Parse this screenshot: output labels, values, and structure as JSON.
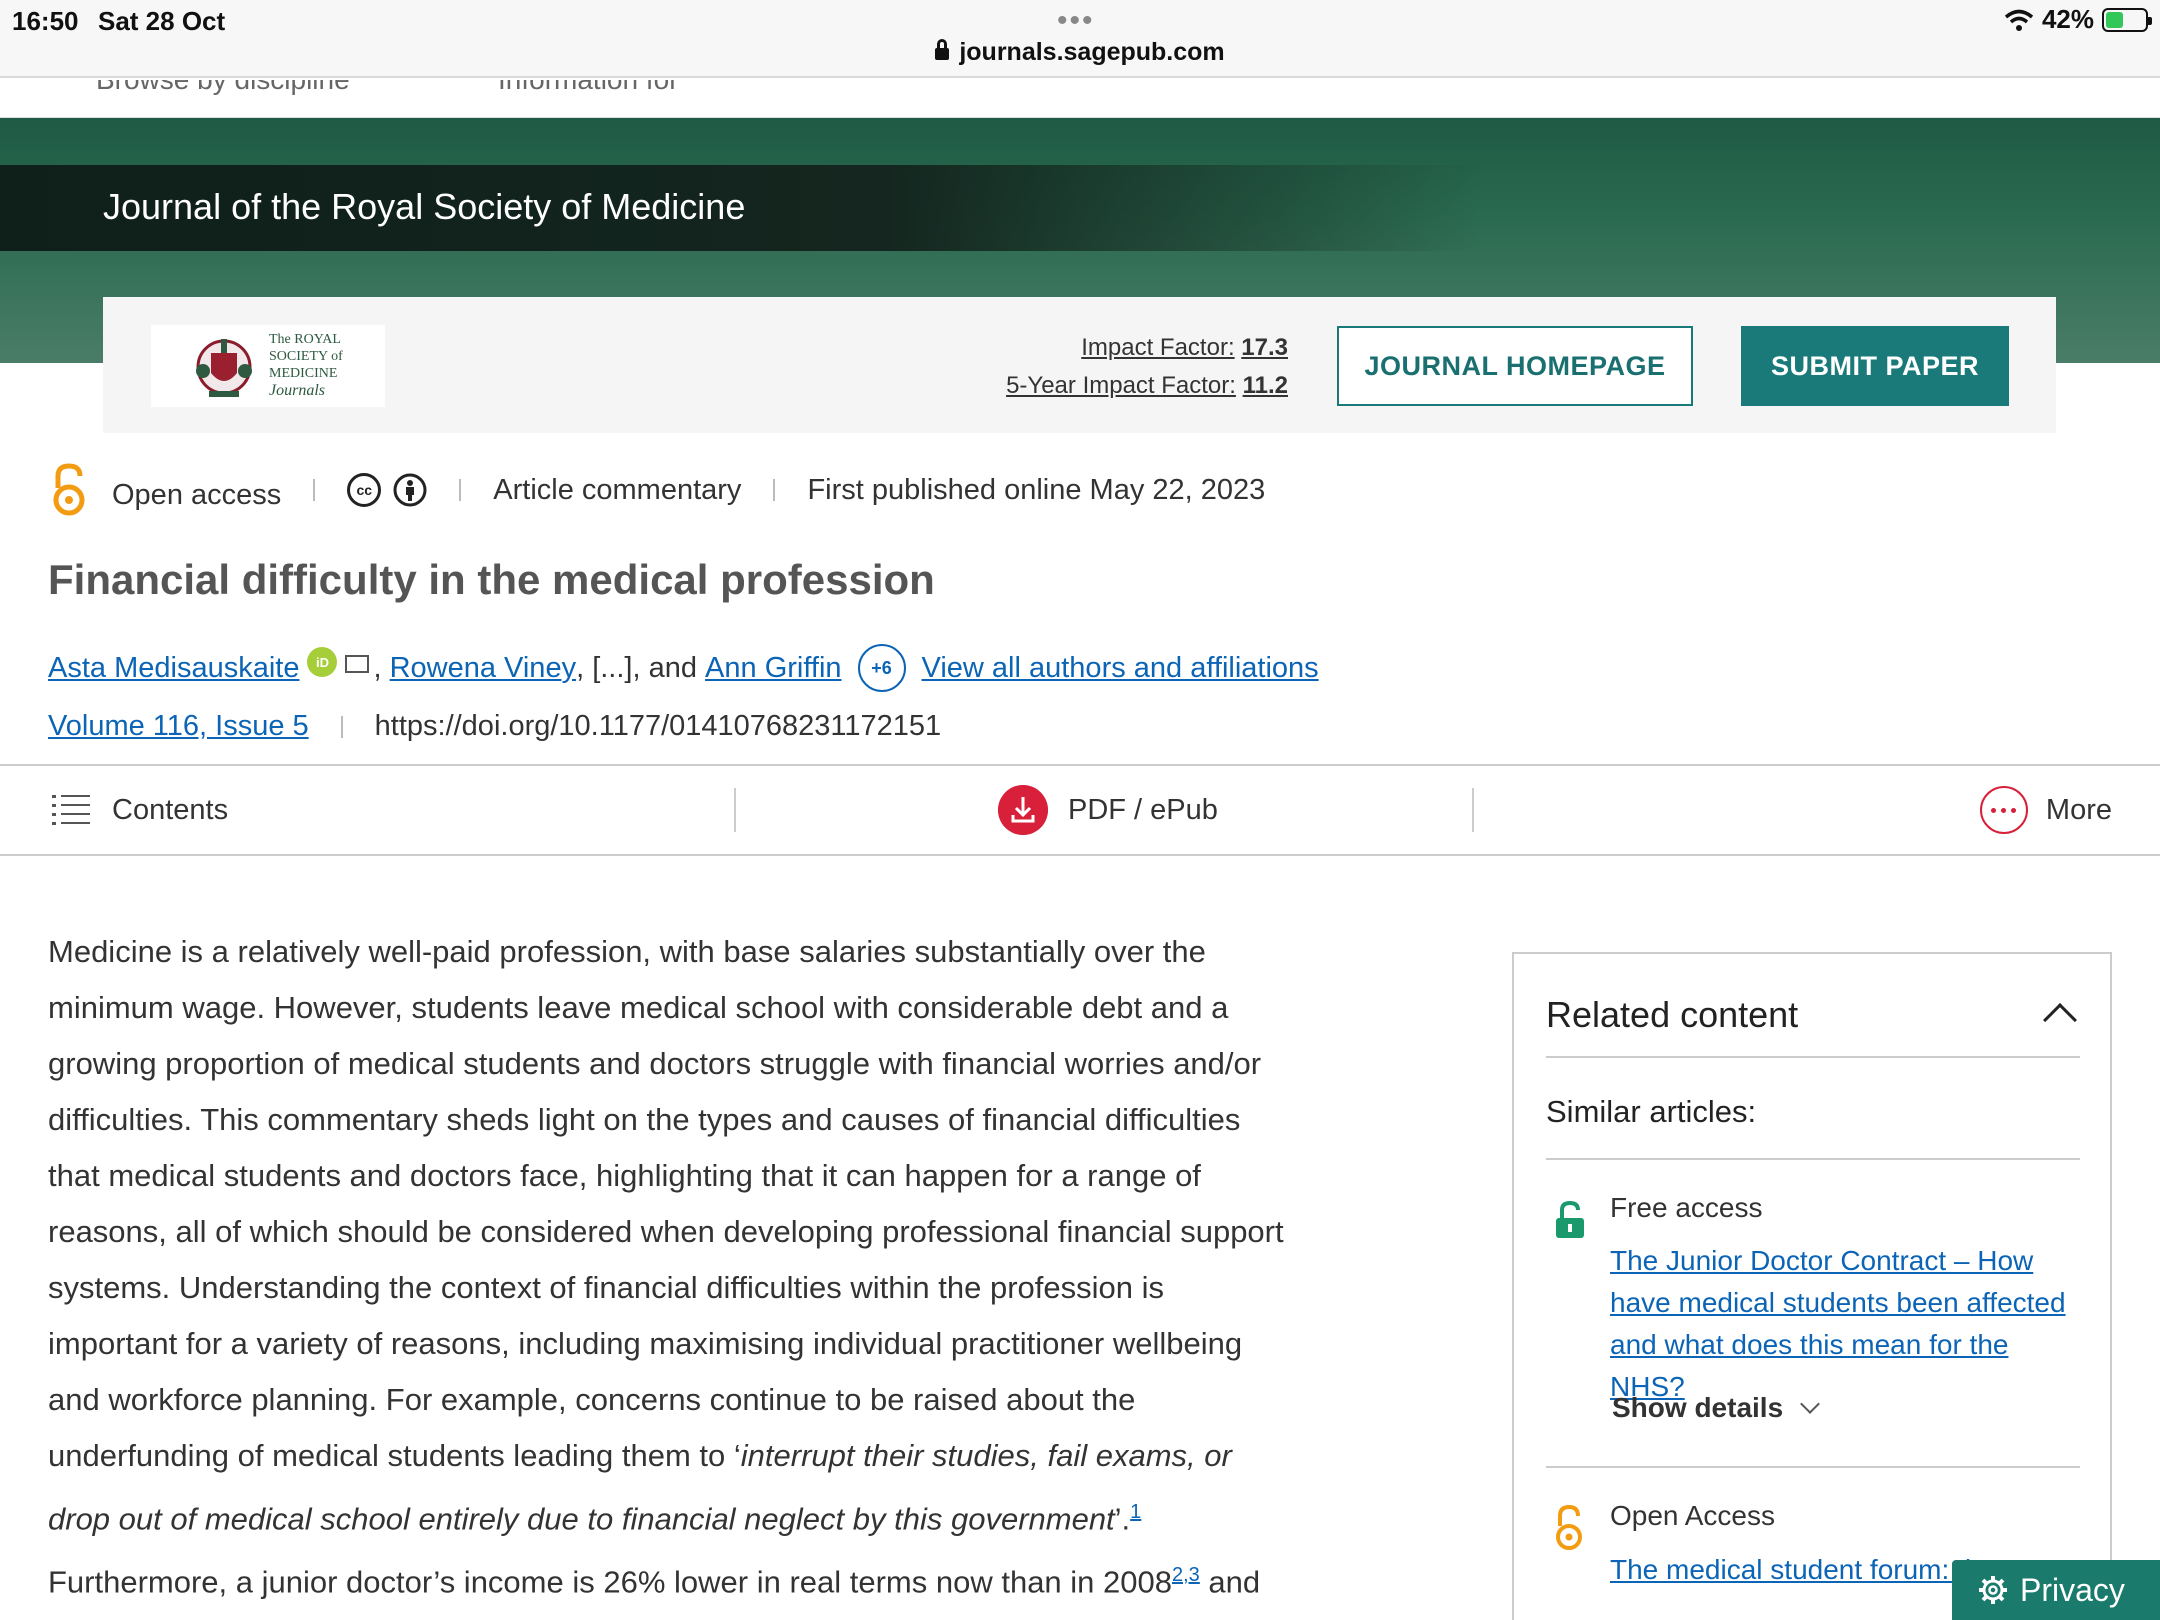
{
  "status_bar": {
    "time": "16:50",
    "date": "Sat 28 Oct",
    "url": "journals.sagepub.com",
    "battery": "42%"
  },
  "subnav": {
    "browse_label": "Browse by discipline",
    "info_label": "Information for"
  },
  "journal": {
    "title": "Journal of the Royal Society of Medicine",
    "logo_line1": "The ROYAL",
    "logo_line2": "SOCIETY of",
    "logo_line3": "MEDICINE",
    "logo_line4": "Journals",
    "impact_label": "Impact Factor:",
    "impact_value": "17.3",
    "impact5_label": "5-Year Impact Factor:",
    "impact5_value": "11.2",
    "homepage_button": "JOURNAL HOMEPAGE",
    "submit_button": "SUBMIT PAPER"
  },
  "meta": {
    "access": "Open access",
    "cc": "cc",
    "type": "Article commentary",
    "published": "First published online May 22, 2023"
  },
  "article": {
    "title": "Financial difficulty in the medical profession",
    "author1": "Asta Medisauskaite",
    "author2": "Rowena Viney",
    "ellipsis": ", [...], and ",
    "author3": "Ann Griffin",
    "more_count": "+6",
    "view_all": "View all authors and affiliations",
    "volume": "Volume 116, Issue 5",
    "doi": "https://doi.org/10.1177/01410768231172151"
  },
  "toolbar": {
    "contents": "Contents",
    "pdf": "PDF / ePub",
    "more": "More"
  },
  "body": {
    "p1": "Medicine is a relatively well-paid profession, with base salaries substantially over the minimum wage. However, students leave medical school with considerable debt and a growing proportion of medical students and doctors struggle with financial worries and/or difficulties. This commentary sheds light on the types and causes of financial difficulties that medical students and doctors face, highlighting that it can happen for a range of reasons, all of which should be considered when developing professional financial support systems. Understanding the context of financial difficulties within the profession is important for a variety of reasons, including maximising individual practitioner wellbeing and workforce planning. For example, concerns continue to be raised about the underfunding of medical students leading them to ‘",
    "quote": "interrupt their studies, fail exams, or drop out of medical school entirely due to financial neglect by this government",
    "after_quote": "’.",
    "ref1": "1",
    "p2": " Furthermore, a junior doctor’s income is 26% lower in real terms now than in 2008",
    "ref2": "2,3",
    "p3": " and may well be"
  },
  "related": {
    "heading": "Related content",
    "similar": "Similar articles:",
    "item1_access": "Free access",
    "item1_title": "The Junior Doctor Contract – How have medical students been affected and what does this mean for the NHS?",
    "item1_details": "Show details",
    "item2_access": "Open Access",
    "item2_title": "The medical student forum: the"
  },
  "privacy": "Privacy",
  "colors": {
    "teal": "#1a7a7a",
    "link": "#0b64b5",
    "pdf_red": "#d8203a",
    "open_access_orange": "#f39c12",
    "free_access_green": "#1a9a6c"
  }
}
